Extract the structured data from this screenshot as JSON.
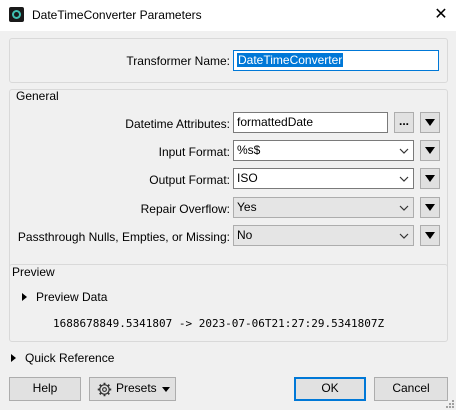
{
  "window": {
    "title": "DateTimeConverter Parameters",
    "icon": "fme-transformer-icon"
  },
  "transformer": {
    "label": "Transformer Name:",
    "value": "DateTimeConverter"
  },
  "general": {
    "legend": "General",
    "datetime_attributes": {
      "label": "Datetime Attributes:",
      "value": "formattedDate",
      "browse_label": "..."
    },
    "input_format": {
      "label": "Input Format:",
      "value": "%s$"
    },
    "output_format": {
      "label": "Output Format:",
      "value": "ISO"
    },
    "repair_overflow": {
      "label": "Repair Overflow:",
      "value": "Yes"
    },
    "passthrough": {
      "label": "Passthrough Nulls, Empties, or Missing:",
      "value": "No"
    }
  },
  "preview": {
    "legend": "Preview",
    "toggle_label": "Preview Data",
    "output": "1688678849.5341807 -> 2023-07-06T21:27:29.5341807Z"
  },
  "quick_reference": {
    "label": "Quick Reference"
  },
  "footer": {
    "help": "Help",
    "presets": "Presets",
    "ok": "OK",
    "cancel": "Cancel"
  }
}
